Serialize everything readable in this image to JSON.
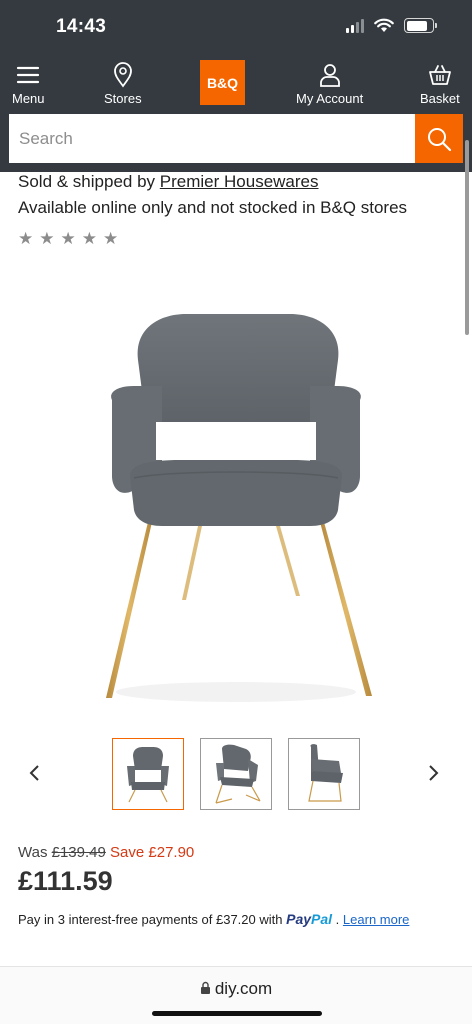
{
  "status_bar": {
    "time": "14:43"
  },
  "nav": {
    "menu_label": "Menu",
    "stores_label": "Stores",
    "logo_text": "B&Q",
    "account_label": "My Account",
    "basket_label": "Basket"
  },
  "search": {
    "placeholder": "Search"
  },
  "product": {
    "seller_prefix": "Sold & shipped by",
    "seller_name": "Premier Housewares",
    "availability": "Available online only and not stocked in B&Q stores",
    "rating_stars": 0,
    "was_label": "Was",
    "was_price": "£139.49",
    "save_text": "Save £27.90",
    "price": "£111.59",
    "paypal_text": "Pay in 3 interest-free payments of £37.20 with",
    "paypal_logo_a": "Pay",
    "paypal_logo_b": "Pal",
    "learn_more": "Learn more"
  },
  "gallery": {
    "active_index": 0,
    "thumb_count": 3
  },
  "browser": {
    "url": "diy.com"
  },
  "colors": {
    "brand_orange": "#f56600",
    "header_bg": "#343a3f",
    "save_red": "#d43a14",
    "link_blue": "#1a66c9",
    "chair_fabric": "#6b7176",
    "chair_legs": "#c99a4b"
  }
}
